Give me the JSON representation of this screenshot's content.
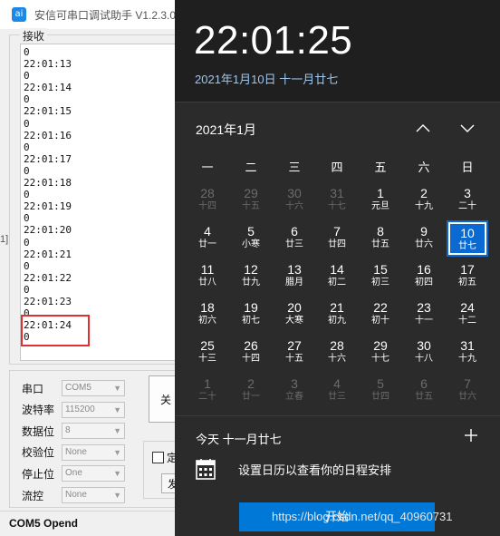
{
  "serial": {
    "title": "安信可串口调试助手 V1.2.3.0",
    "receive_label": "接收",
    "left_edge_glyph": "1]",
    "receive_lines": [
      "0",
      "22:01:13",
      "0",
      "22:01:14",
      "0",
      "22:01:15",
      "0",
      "22:01:16",
      "0",
      "22:01:17",
      "0",
      "22:01:18",
      "0",
      "22:01:19",
      "0",
      "22:01:20",
      "0",
      "22:01:21",
      "0",
      "22:01:22",
      "0",
      "22:01:23",
      "0",
      "22:01:24",
      "0"
    ],
    "settings": [
      {
        "label": "串口",
        "value": "COM5"
      },
      {
        "label": "波特率",
        "value": "115200"
      },
      {
        "label": "数据位",
        "value": "8"
      },
      {
        "label": "校验位",
        "value": "None"
      },
      {
        "label": "停止位",
        "value": "One"
      },
      {
        "label": "流控",
        "value": "None"
      }
    ],
    "close_button": "关",
    "option_text": "定",
    "option_button": "发",
    "status": "COM5 Opend",
    "highlight_color": "#e03030"
  },
  "flyout": {
    "time": "22:01:25",
    "date": "2021年1月10日 十一月廿七",
    "month_title": "2021年1月",
    "weekdays": [
      "一",
      "二",
      "三",
      "四",
      "五",
      "六",
      "日"
    ],
    "weeks": [
      [
        {
          "d": "28",
          "l": "十四",
          "o": true
        },
        {
          "d": "29",
          "l": "十五",
          "o": true
        },
        {
          "d": "30",
          "l": "十六",
          "o": true
        },
        {
          "d": "31",
          "l": "十七",
          "o": true
        },
        {
          "d": "1",
          "l": "元旦"
        },
        {
          "d": "2",
          "l": "十九"
        },
        {
          "d": "3",
          "l": "二十"
        }
      ],
      [
        {
          "d": "4",
          "l": "廿一"
        },
        {
          "d": "5",
          "l": "小寒"
        },
        {
          "d": "6",
          "l": "廿三"
        },
        {
          "d": "7",
          "l": "廿四"
        },
        {
          "d": "8",
          "l": "廿五"
        },
        {
          "d": "9",
          "l": "廿六"
        },
        {
          "d": "10",
          "l": "廿七",
          "t": true
        }
      ],
      [
        {
          "d": "11",
          "l": "廿八"
        },
        {
          "d": "12",
          "l": "廿九"
        },
        {
          "d": "13",
          "l": "腊月"
        },
        {
          "d": "14",
          "l": "初二"
        },
        {
          "d": "15",
          "l": "初三"
        },
        {
          "d": "16",
          "l": "初四"
        },
        {
          "d": "17",
          "l": "初五"
        }
      ],
      [
        {
          "d": "18",
          "l": "初六"
        },
        {
          "d": "19",
          "l": "初七"
        },
        {
          "d": "20",
          "l": "大寒"
        },
        {
          "d": "21",
          "l": "初九"
        },
        {
          "d": "22",
          "l": "初十"
        },
        {
          "d": "23",
          "l": "十一"
        },
        {
          "d": "24",
          "l": "十二"
        }
      ],
      [
        {
          "d": "25",
          "l": "十三"
        },
        {
          "d": "26",
          "l": "十四"
        },
        {
          "d": "27",
          "l": "十五"
        },
        {
          "d": "28",
          "l": "十六"
        },
        {
          "d": "29",
          "l": "十七"
        },
        {
          "d": "30",
          "l": "十八"
        },
        {
          "d": "31",
          "l": "十九"
        }
      ],
      [
        {
          "d": "1",
          "l": "二十",
          "o": true
        },
        {
          "d": "2",
          "l": "廿一",
          "o": true
        },
        {
          "d": "3",
          "l": "立春",
          "o": true
        },
        {
          "d": "4",
          "l": "廿三",
          "o": true
        },
        {
          "d": "5",
          "l": "廿四",
          "o": true
        },
        {
          "d": "6",
          "l": "廿五",
          "o": true
        },
        {
          "d": "7",
          "l": "廿六",
          "o": true
        }
      ]
    ],
    "today_line": "今天 十一月廿七",
    "agenda_text": "设置日历以查看你的日程安排",
    "start_button": "开始",
    "watermark": "https://blog.csdn.net/qq_40960731",
    "accent_color": "#0078d7"
  }
}
